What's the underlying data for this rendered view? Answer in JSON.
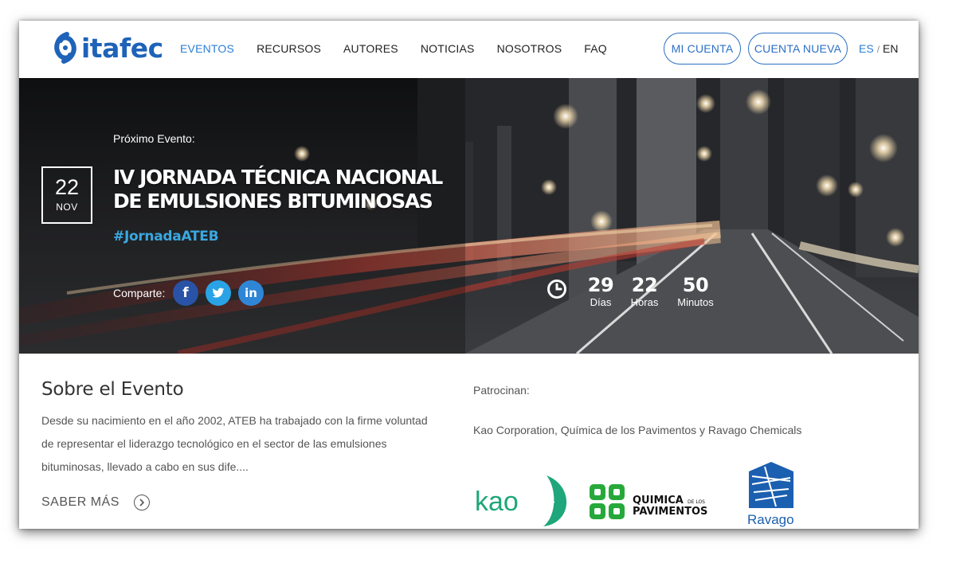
{
  "header": {
    "logo_text": "itafec",
    "nav": [
      "EVENTOS",
      "RECURSOS",
      "AUTORES",
      "NOTICIAS",
      "NOSOTROS",
      "FAQ"
    ],
    "active_nav": "EVENTOS",
    "account_button": "MI CUENTA",
    "new_account_button": "CUENTA NUEVA",
    "lang_es": "ES",
    "lang_sep": "/",
    "lang_en": "EN"
  },
  "hero": {
    "next_label": "Próximo Evento:",
    "date_day": "22",
    "date_month": "NOV",
    "title": "IV JORNADA TÉCNICA NACIONAL DE EMULSIONES BITUMINOSAS",
    "hashtag": "#JornadaATEB",
    "share_label": "Comparte:",
    "social": {
      "facebook": "f",
      "twitter": "t",
      "linkedin": "in"
    },
    "countdown": {
      "days": "29",
      "days_label": "Días",
      "hours": "22",
      "hours_label": "Horas",
      "minutes": "50",
      "minutes_label": "Minutos"
    }
  },
  "about": {
    "title": "Sobre el Evento",
    "text": "Desde su nacimiento en el año 2002, ATEB ha trabajado con la firme voluntad de representar el liderazgo tecnológico en el sector de las emulsiones bituminosas, llevado a cabo en sus dife....",
    "more": "SABER MÁS"
  },
  "sponsors": {
    "label": "Patrocinan:",
    "names": "Kao Corporation, Química de los Pavimentos y Ravago Chemicals",
    "logos": {
      "kao": "kao",
      "qp_line1": "QUIMICA",
      "qp_small": "DE LOS",
      "qp_line2": "PAVIMENTOS",
      "ravago": "Ravago"
    }
  },
  "colors": {
    "brand_blue": "#2b6fc4",
    "accent": "#39a8e0",
    "kao_green": "#1fa67a",
    "qp_green": "#27a83a",
    "ravago_blue": "#1b5fb0"
  }
}
